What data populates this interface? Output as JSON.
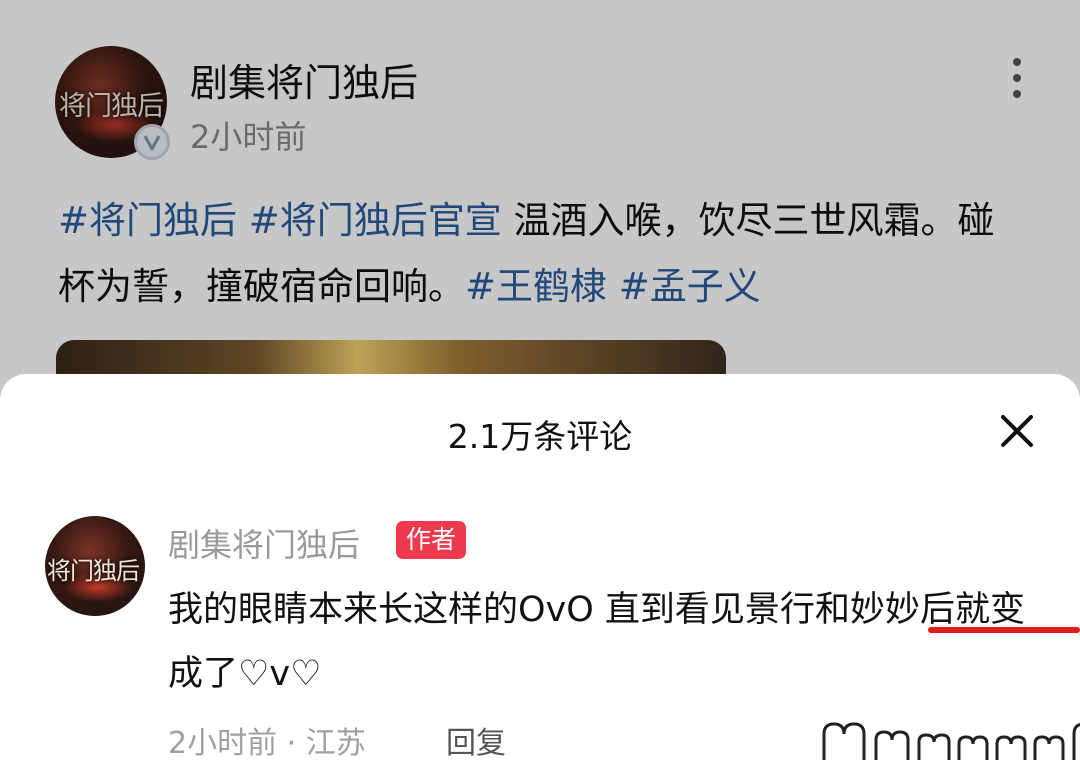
{
  "post": {
    "account_name": "剧集将门独后",
    "avatar_text": "将门独后",
    "time": "2小时前",
    "text_segments": [
      {
        "text": "#将门独后",
        "tag": true
      },
      {
        "text": " ",
        "tag": false
      },
      {
        "text": "#将门独后官宣",
        "tag": true
      },
      {
        "text": " 温酒入喉，饮尽三世风霜。碰杯为誓，撞破宿命回响。",
        "tag": false
      },
      {
        "text": "#王鹤棣",
        "tag": true
      },
      {
        "text": " ",
        "tag": false
      },
      {
        "text": "#孟子义",
        "tag": true
      }
    ],
    "verified_icon": "verified-v-icon",
    "more_icon": "more-vertical-icon"
  },
  "comments_sheet": {
    "title": "2.1万条评论",
    "close_icon": "close-x-icon",
    "comment": {
      "author_name": "剧集将门独后",
      "avatar_text": "将门独后",
      "author_badge": "作者",
      "text": "我的眼睛本来长这样的OvO 直到看见景行和妙妙后就变成了♡v♡",
      "meta": "2小时前 · 江苏",
      "reply_label": "回复"
    }
  },
  "colors": {
    "tag_blue": "#2b5c9e",
    "badge_red": "#ee3a4d",
    "underline_red": "#e01d1d"
  }
}
